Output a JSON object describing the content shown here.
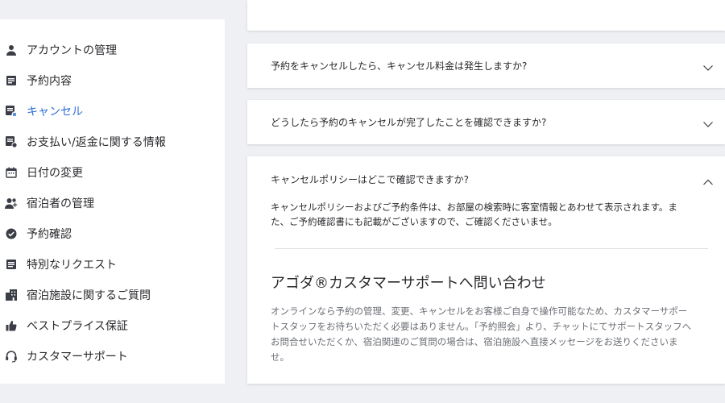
{
  "sidebar": {
    "items": [
      {
        "label": "アカウントの管理",
        "icon": "person-icon",
        "active": false
      },
      {
        "label": "予約内容",
        "icon": "document-icon",
        "active": false
      },
      {
        "label": "キャンセル",
        "icon": "cancel-document-icon",
        "active": true
      },
      {
        "label": "お支払い/返金に関する情報",
        "icon": "payment-document-icon",
        "active": false
      },
      {
        "label": "日付の変更",
        "icon": "calendar-icon",
        "active": false
      },
      {
        "label": "宿泊者の管理",
        "icon": "guests-icon",
        "active": false
      },
      {
        "label": "予約確認",
        "icon": "check-circle-icon",
        "active": false
      },
      {
        "label": "特別なリクエスト",
        "icon": "list-icon",
        "active": false
      },
      {
        "label": "宿泊施設に関するご質問",
        "icon": "building-icon",
        "active": false
      },
      {
        "label": "ベストプライス保証",
        "icon": "thumbs-up-icon",
        "active": false
      },
      {
        "label": "カスタマーサポート",
        "icon": "headset-icon",
        "active": false
      }
    ]
  },
  "faq": {
    "q1": "予約をキャンセルしたら、キャンセル料金は発生しますか?",
    "q2": "どうしたら予約のキャンセルが完了したことを確認できますか?",
    "q3": "キャンセルポリシーはどこで確認できますか?",
    "a3_line1": "キャンセルポリシーおよびご予約条件は、お部屋の検索時に客室情報とあわせて表示されます。ま",
    "a3_line2": "た、ご予約確認書にも記載がございますので、ご確認くださいませ。"
  },
  "support": {
    "title": "アゴダ®カスタマーサポートへ問い合わせ",
    "line1": "オンラインなら予約の管理、変更、キャンセルをお客様ご自身で操作可能なため、カスタマーサポー",
    "line2": "トスタッフをお待ちいただく必要はありません。「予約照会」より、チャットにてサポートスタッフへ",
    "line3": "お問合せいただくか、宿泊関連のご質問の場合は、宿泊施設へ直接メッセージをお送りくださいま",
    "line4": "せ。"
  },
  "colors": {
    "accent": "#2f6fd6",
    "icon": "#3a3d45",
    "page_bg": "#eef0f4"
  }
}
